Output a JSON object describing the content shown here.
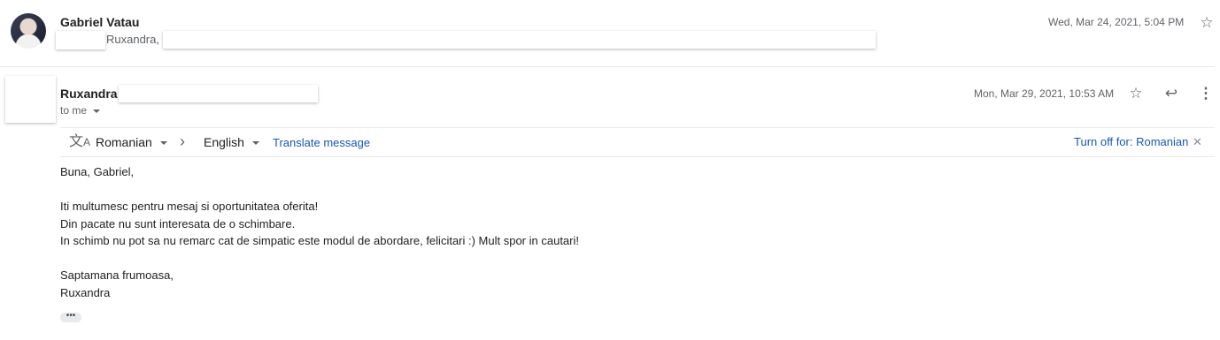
{
  "message1": {
    "sender": "Gabriel Vatau",
    "snippet": "Ruxandra,",
    "date": "Wed, Mar 24, 2021, 5:04 PM"
  },
  "message2": {
    "sender": "Ruxandra",
    "recipient": "to me",
    "date": "Mon, Mar 29, 2021, 10:53 AM"
  },
  "translate_bar": {
    "source_lang": "Romanian",
    "target_lang": "English",
    "translate_link": "Translate message",
    "turn_off_link": "Turn off for: Romanian"
  },
  "body": {
    "greeting": "Buna, Gabriel,",
    "line1": "Iti multumesc pentru mesaj si oportunitatea oferita!",
    "line2": "Din pacate nu sunt interesata de o schimbare.",
    "line3": "In schimb nu pot sa nu remarc cat de simpatic este modul de abordare, felicitari :) Mult spor in cautari!",
    "closing": "Saptamana frumoasa,",
    "signature": "Ruxandra"
  },
  "icons": {
    "star": "star-icon",
    "reply": "reply-icon",
    "more": "more-vertical-icon",
    "translate": "translate-icon",
    "arrow": "chevron-right-icon",
    "close": "close-icon",
    "ellipsis": "show-trimmed-content-icon"
  }
}
